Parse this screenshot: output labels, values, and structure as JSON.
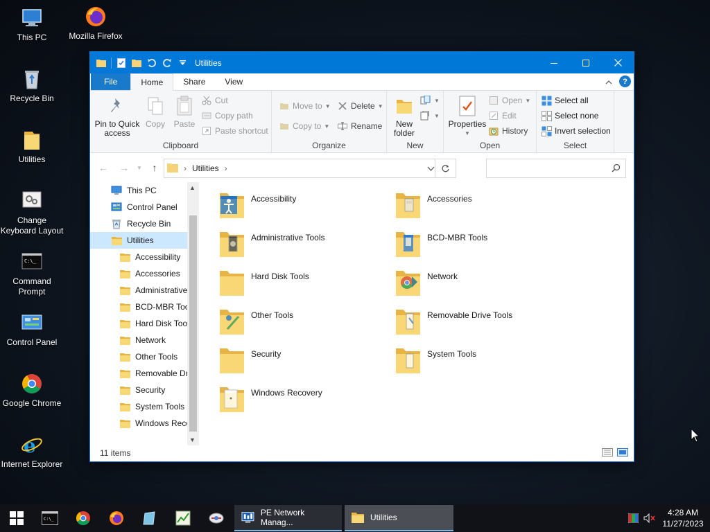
{
  "desktop": {
    "icons": [
      {
        "label": "This PC"
      },
      {
        "label": "Mozilla Firefox"
      },
      {
        "label": "Recycle Bin"
      },
      {
        "label": "Utilities"
      },
      {
        "label": "Change Keyboard Layout"
      },
      {
        "label": "Command Prompt"
      },
      {
        "label": "Control Panel"
      },
      {
        "label": "Google Chrome"
      },
      {
        "label": "Internet Explorer"
      }
    ]
  },
  "window": {
    "title": "Utilities",
    "tabs": [
      "File",
      "Home",
      "Share",
      "View"
    ],
    "active_tab": "Home",
    "ribbon": {
      "clipboard": {
        "label": "Clipboard",
        "pin": "Pin to Quick access",
        "copy": "Copy",
        "paste": "Paste",
        "cut": "Cut",
        "copy_path": "Copy path",
        "paste_shortcut": "Paste shortcut"
      },
      "organize": {
        "label": "Organize",
        "move_to": "Move to",
        "copy_to": "Copy to",
        "delete": "Delete",
        "rename": "Rename"
      },
      "new": {
        "label": "New",
        "new_folder": "New folder"
      },
      "open": {
        "label": "Open",
        "properties": "Properties",
        "open": "Open",
        "edit": "Edit",
        "history": "History"
      },
      "select": {
        "label": "Select",
        "select_all": "Select all",
        "select_none": "Select none",
        "invert": "Invert selection"
      }
    },
    "address": {
      "path": "Utilities",
      "search_placeholder": ""
    },
    "nav": {
      "items": [
        {
          "label": "This PC"
        },
        {
          "label": "Control Panel"
        },
        {
          "label": "Recycle Bin"
        },
        {
          "label": "Utilities"
        },
        {
          "label": "Accessibility"
        },
        {
          "label": "Accessories"
        },
        {
          "label": "Administrative Tools"
        },
        {
          "label": "BCD-MBR Tools"
        },
        {
          "label": "Hard Disk Tools"
        },
        {
          "label": "Network"
        },
        {
          "label": "Other Tools"
        },
        {
          "label": "Removable Drive Tools"
        },
        {
          "label": "Security"
        },
        {
          "label": "System Tools"
        },
        {
          "label": "Windows Recovery"
        }
      ]
    },
    "items": [
      {
        "label": "Accessibility"
      },
      {
        "label": "Accessories"
      },
      {
        "label": "Administrative Tools"
      },
      {
        "label": "BCD-MBR Tools"
      },
      {
        "label": "Hard Disk Tools"
      },
      {
        "label": "Network"
      },
      {
        "label": "Other Tools"
      },
      {
        "label": "Removable Drive Tools"
      },
      {
        "label": "Security"
      },
      {
        "label": "System Tools"
      },
      {
        "label": "Windows Recovery"
      }
    ],
    "status": {
      "count": "11 items"
    }
  },
  "taskbar": {
    "tasks": [
      {
        "label": "PE Network Manag..."
      },
      {
        "label": "Utilities"
      }
    ],
    "clock": {
      "time": "4:28 AM",
      "date": "11/27/2023"
    }
  },
  "colors": {
    "accent": "#0078d7",
    "folder": "#f5d376",
    "selection": "#cce8ff"
  }
}
